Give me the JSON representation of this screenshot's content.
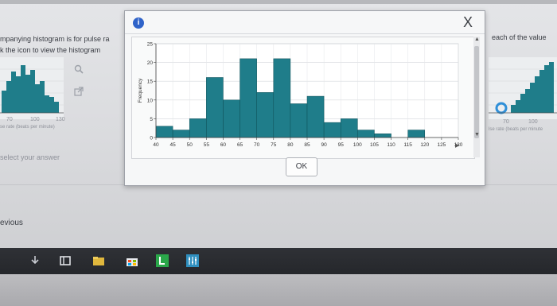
{
  "background": {
    "left_line1": "mpanying histogram is for pulse ra",
    "left_line2": "k the icon to view the histogram",
    "left_axis_ticks": [
      "70",
      "100",
      "130"
    ],
    "left_axis_label": "se rate (beats per minute)",
    "right_line1": "each of the value",
    "right_axis_ticks": [
      "70",
      "100"
    ],
    "right_axis_label": "lse rate (beats per minute",
    "select_answer": "select your answer",
    "previous": "evious"
  },
  "modal": {
    "info_icon": "i",
    "close": "X",
    "ok_label": "OK"
  },
  "chart_data": {
    "type": "bar",
    "ylabel": "Frequency",
    "xlabel": "",
    "ylim": [
      0,
      25
    ],
    "yticks": [
      "0",
      "5",
      "10",
      "15",
      "20",
      "25"
    ],
    "xticks": [
      "40",
      "45",
      "50",
      "55",
      "60",
      "65",
      "70",
      "75",
      "80",
      "85",
      "90",
      "95",
      "100",
      "105",
      "110",
      "115",
      "120",
      "125",
      "130"
    ],
    "bin_edges": [
      40,
      45,
      50,
      55,
      60,
      65,
      70,
      75,
      80,
      85,
      90,
      95,
      100,
      105,
      110,
      115,
      120,
      125
    ],
    "values": [
      3,
      2,
      5,
      16,
      10,
      21,
      12,
      21,
      9,
      11,
      4,
      5,
      2,
      1,
      0,
      2,
      0
    ],
    "bar_color": "#1f7d8a",
    "grid": true
  },
  "taskbar": {
    "icons": [
      "download-icon",
      "task-view-icon",
      "file-explorer-icon",
      "store-icon",
      "l-app-icon",
      "tools-app-icon"
    ]
  }
}
